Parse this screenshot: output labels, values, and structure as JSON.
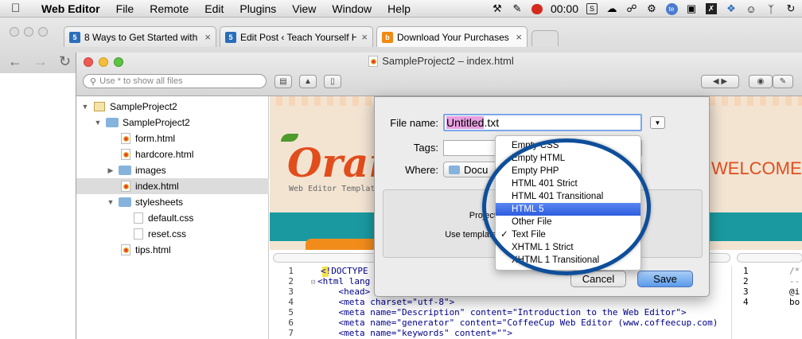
{
  "menubar": {
    "app": "Web Editor",
    "items": [
      "File",
      "Remote",
      "Edit",
      "Plugins",
      "View",
      "Window",
      "Help"
    ],
    "clock": "00:00"
  },
  "browser": {
    "tabs": [
      {
        "title": "8 Ways to Get Started with",
        "favicon": "html5-icon",
        "color": "#2a6ebb"
      },
      {
        "title": "Edit Post ‹ Teach Yourself H",
        "favicon": "html5-icon",
        "color": "#2a6ebb"
      },
      {
        "title": "Download Your Purchases",
        "favicon": "bag-icon",
        "color": "#f08a12"
      }
    ]
  },
  "window": {
    "title": "SampleProject2 – index.html",
    "search_placeholder": "Use * to show all files"
  },
  "tree": [
    {
      "label": "SampleProject2",
      "kind": "project",
      "depth": 0,
      "open": true
    },
    {
      "label": "SampleProject2",
      "kind": "folder",
      "depth": 1,
      "open": true
    },
    {
      "label": "form.html",
      "kind": "html",
      "depth": 2
    },
    {
      "label": "hardcore.html",
      "kind": "html",
      "depth": 2
    },
    {
      "label": "images",
      "kind": "folder",
      "depth": 1,
      "open": false
    },
    {
      "label": "index.html",
      "kind": "html",
      "depth": 2,
      "selected": true
    },
    {
      "label": "stylesheets",
      "kind": "folder",
      "depth": 1,
      "open": true
    },
    {
      "label": "default.css",
      "kind": "css",
      "depth": 3
    },
    {
      "label": "reset.css",
      "kind": "css",
      "depth": 3
    },
    {
      "label": "tips.html",
      "kind": "html",
      "depth": 2
    }
  ],
  "preview": {
    "logo": "Orang",
    "tagline": "Web Editor Templat",
    "welcome": "WELCOME"
  },
  "code": [
    {
      "n": "1",
      "t": "<!DOCTYPE "
    },
    {
      "n": "2",
      "t": "<html lang"
    },
    {
      "n": "3",
      "t": "    <head>"
    },
    {
      "n": "4",
      "t": "    <meta charset=\"utf-8\">"
    },
    {
      "n": "5",
      "t": "    <meta name=\"Description\" content=\"Introduction to the Web Editor\">"
    },
    {
      "n": "6",
      "t": "    <meta name=\"generator\" content=\"CoffeeCup Web Editor (www.coffeecup.com)"
    },
    {
      "n": "7",
      "t": "    <meta name=\"keywords\" content=\"\">"
    }
  ],
  "code_right": [
    {
      "n": "1",
      "t": "/*"
    },
    {
      "n": "2",
      "t": "--"
    },
    {
      "n": "3",
      "t": "@i"
    },
    {
      "n": "4",
      "t": "bo"
    }
  ],
  "dialog": {
    "file_name_label": "File name:",
    "file_name_selected": "Untitled",
    "file_name_rest": ".txt",
    "tags_label": "Tags:",
    "where_label": "Where:",
    "where_value": "Docu",
    "project_label": "Project",
    "template_label": "Use template",
    "cancel": "Cancel",
    "save": "Save"
  },
  "template_menu": {
    "items": [
      {
        "label": "Empty CSS"
      },
      {
        "label": "Empty HTML"
      },
      {
        "label": "Empty PHP"
      },
      {
        "label": "HTML 401 Strict"
      },
      {
        "label": "HTML 401 Transitional"
      },
      {
        "label": "HTML 5",
        "highlighted": true
      },
      {
        "label": "Other File"
      },
      {
        "label": "Text File",
        "checked": true
      },
      {
        "label": "XHTML 1 Strict"
      },
      {
        "label": "XHTML 1 Transitional"
      }
    ]
  },
  "colors": {
    "accent": "#2d5de0",
    "callout": "#0e4e9a",
    "brand_orange": "#e24d1c",
    "teal": "#1a9aa0"
  }
}
